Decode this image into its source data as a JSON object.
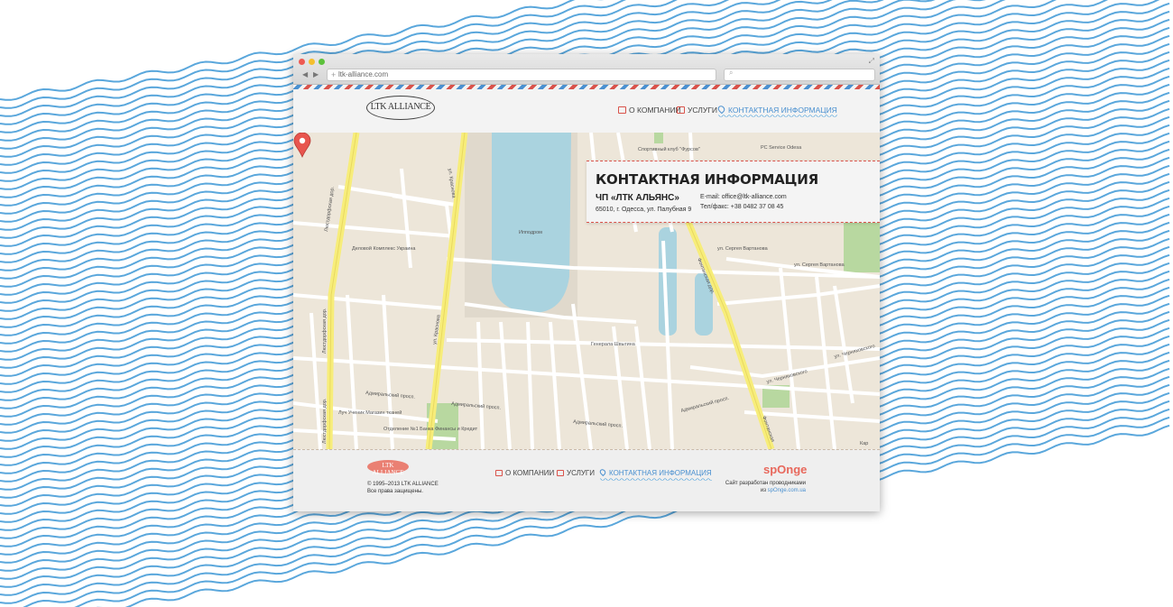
{
  "browser": {
    "url": "ltk-alliance.com",
    "back": "◀",
    "forward": "▶"
  },
  "header": {
    "logo_text": "LTK ALLIANCE",
    "nav": [
      {
        "label": "О компании",
        "icon": "page-icon"
      },
      {
        "label": "Услуги",
        "icon": "briefcase-icon"
      },
      {
        "label": "Контактная информация",
        "icon": "map-pin-icon",
        "active": true
      }
    ]
  },
  "contact": {
    "title": "КОНТАКТНАЯ ИНФОРМАЦИЯ",
    "company": "ЧП «ЛТК АЛЬЯНС»",
    "address": "65010, г. Одесса, ул. Палубная 9",
    "email": "E-mail: office@ltk-alliance.com",
    "phone": "Тел/факс: +38 0482 37 08 45"
  },
  "map": {
    "labels": {
      "hippodrome": "Ипподром",
      "sport_club": "Спортивный клуб \"Фурсов\"",
      "admiral1": "Адмиральский просп.",
      "admiral2": "Адмиральский просп.",
      "admiral3": "Адмиральский просп.",
      "admiral4": "Адмиральский просп.",
      "krasnova1": "ул. Краснова",
      "krasnova2": "ул. Краснова",
      "lyustdorf1": "Люстдорфская дор.",
      "lyustdorf2": "Люстдорфская дор.",
      "lyustdorf3": "Люстдорфская дор.",
      "fontan1": "Фонтанская дор.",
      "fontan2": "Фонтанская",
      "shmidt": "Генерала Швыгина",
      "chernyakhovskogo1": "ул. Черняховского",
      "chernyakhovskogo2": "ул. Черняховского",
      "vartanova1": "ул. Сергея Вартанова",
      "vartanova2": "ул. Сергея Вартанова",
      "bank": "Отделение №1 Банка Финансы и Кредит",
      "shop": "Луч Ученик Магазин тканей",
      "komplex": "Деловой Комплекс Украина",
      "service": "РС Service Odesa",
      "kar": "Кар"
    },
    "marker_icon": "map-marker-icon"
  },
  "footer": {
    "logo_text": "LTK ALLIANCE",
    "copyright": "© 1995–2013 LTK ALLIANCE",
    "rights": "Все права защищены.",
    "nav": [
      {
        "label": "О компании"
      },
      {
        "label": "Услуги"
      },
      {
        "label": "Контактная информация"
      }
    ],
    "sponge_logo": "spOnge",
    "credit_line1": "Сайт разработан проводниками",
    "credit_line2_prefix": "из",
    "credit_link": "spOnge.com.ua"
  },
  "colors": {
    "accent_red": "#d9524a",
    "accent_blue": "#4a90d0",
    "wave_blue": "#5aa7dc",
    "map_road_yellow": "#f7ed7a",
    "map_water": "#aad3df",
    "map_green": "#b8d8a0"
  }
}
